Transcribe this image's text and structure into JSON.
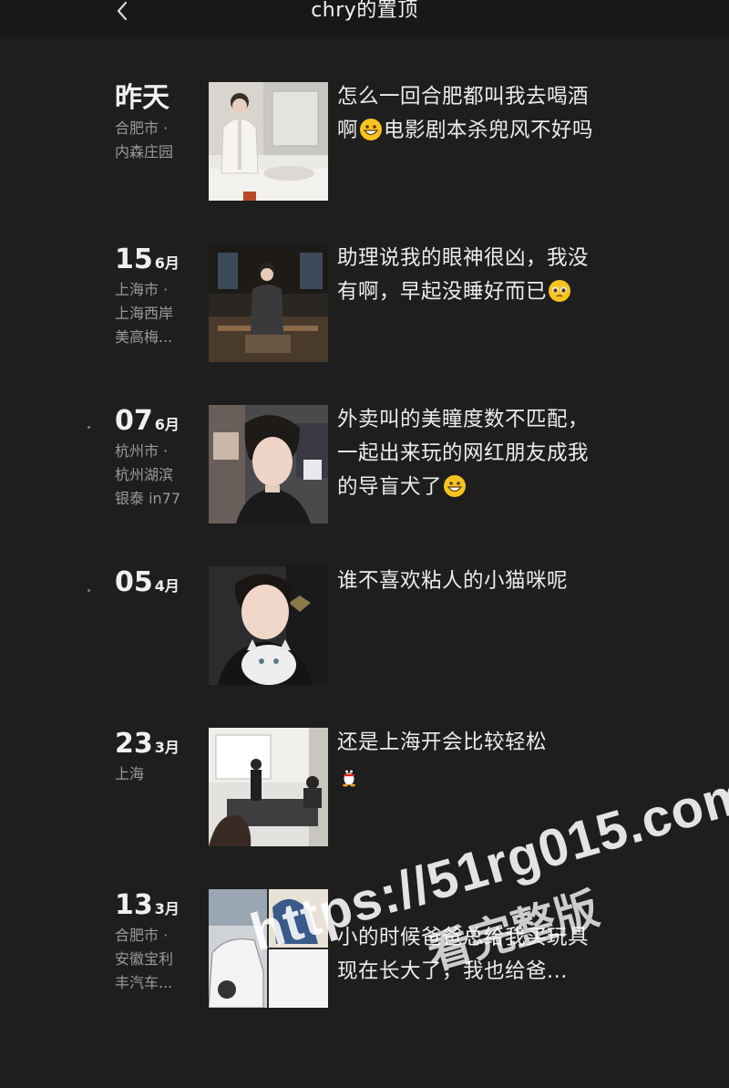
{
  "header": {
    "title": "chry的置顶",
    "back_icon": "chevron-left-icon"
  },
  "posts": [
    {
      "date_today": "昨天",
      "location": "合肥市 ·\n内森庄园",
      "text_before_emoji": "怎么一回合肥都叫我去喝酒啊",
      "emoji": "grinning-face-icon",
      "text_after_emoji": "电影剧本杀兜风不好吗",
      "image": "man-in-bathroom-photo"
    },
    {
      "day": "15",
      "month": "6月",
      "location": "上海市 ·\n上海西岸\n美高梅...",
      "text_before_emoji": "助理说我的眼神很凶，我没有啊，早起没睡好而已",
      "emoji": "pleading-face-icon",
      "text_after_emoji": "",
      "image": "man-in-office-photo"
    },
    {
      "day": "07",
      "month": "6月",
      "location": "杭州市 ·\n杭州湖滨\n银泰 in77",
      "text_before_emoji": "外卖叫的美瞳度数不匹配，一起出来玩的网红朋友成我的导盲犬了",
      "emoji": "grinning-face-icon",
      "text_after_emoji": "",
      "image": "man-selfie-street-photo"
    },
    {
      "day": "05",
      "month": "4月",
      "location": "",
      "text_before_emoji": "谁不喜欢粘人的小猫咪呢",
      "emoji": "",
      "text_after_emoji": "",
      "image": "man-with-cat-photo"
    },
    {
      "day": "23",
      "month": "3月",
      "location": "上海",
      "text_before_emoji": "还是上海开会比较轻松",
      "emoji": "penguin-icon",
      "text_after_emoji": "",
      "image": "meeting-room-photo"
    },
    {
      "day": "13",
      "month": "3月",
      "location": "合肥市 ·\n安徽宝利\n丰汽车...",
      "text_before_emoji": "小的时候爸爸总给我买玩具\n现在长大了，我也给爸...",
      "emoji": "",
      "text_after_emoji": "",
      "image": "car-and-sketch-collage-photo"
    }
  ],
  "watermark": {
    "line1": "https://51rg015.com",
    "line2": "看完整版"
  },
  "colors": {
    "background": "#1e1e1e",
    "topbar": "#181818",
    "text_primary": "#ececec",
    "text_secondary": "#9a9a9a",
    "emoji_yellow": "#f7c31f"
  }
}
